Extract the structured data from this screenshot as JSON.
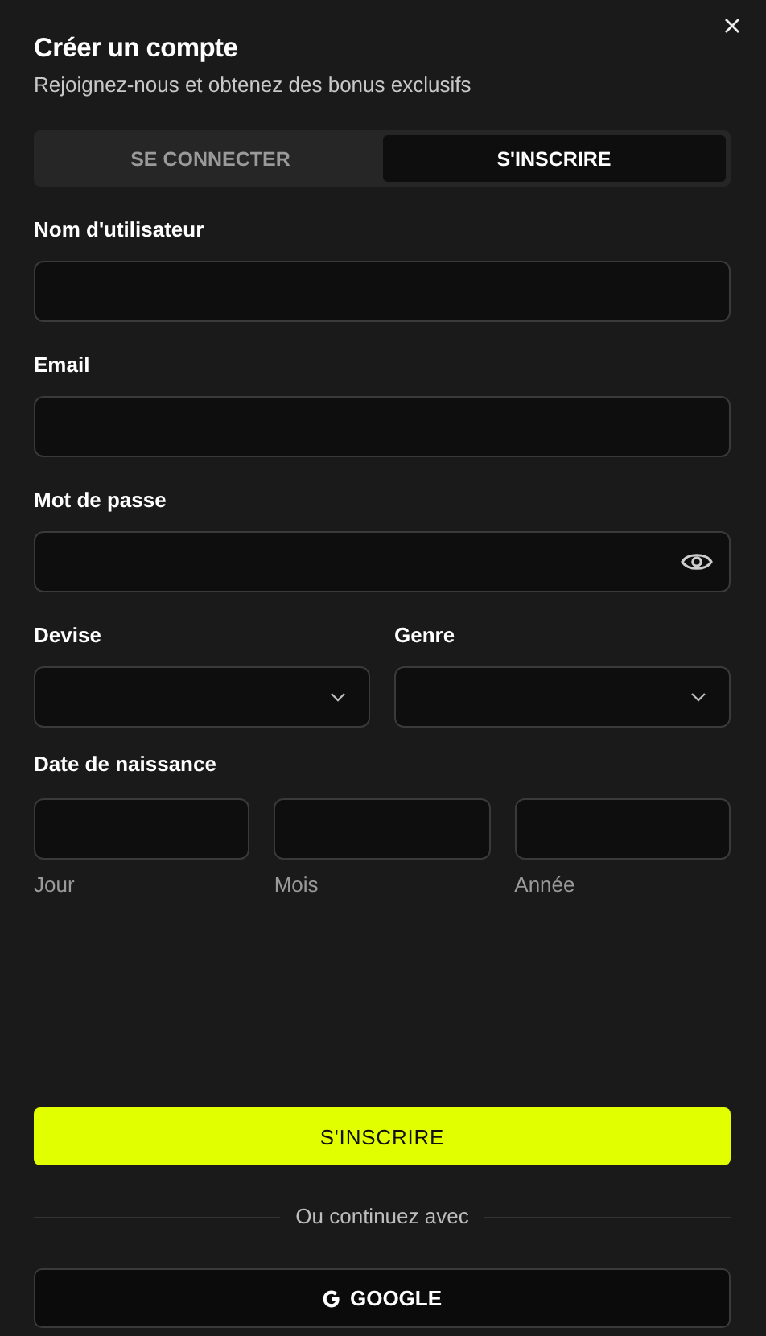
{
  "title": "Créer un compte",
  "subtitle": "Rejoignez-nous et obtenez des bonus exclusifs",
  "tabs": [
    {
      "label": "SE CONNECTER",
      "selected": false
    },
    {
      "label": "S'INSCRIRE",
      "selected": true
    }
  ],
  "fields": [
    {
      "kind": "text",
      "label": "Nom d'utilisateur"
    },
    {
      "kind": "text",
      "label": "Email"
    },
    {
      "kind": "password",
      "label": "Mot de passe"
    }
  ],
  "selects": [
    {
      "label": "Devise"
    },
    {
      "label": "Genre"
    }
  ],
  "birth_date": {
    "label": "Date de naissance",
    "parts": [
      {
        "caption": "Jour"
      },
      {
        "caption": "Mois"
      },
      {
        "caption": "Année"
      }
    ]
  },
  "submit": "S'INSCRIRE",
  "divider": "Ou continuez avec",
  "social": {
    "label": "GOOGLE"
  }
}
